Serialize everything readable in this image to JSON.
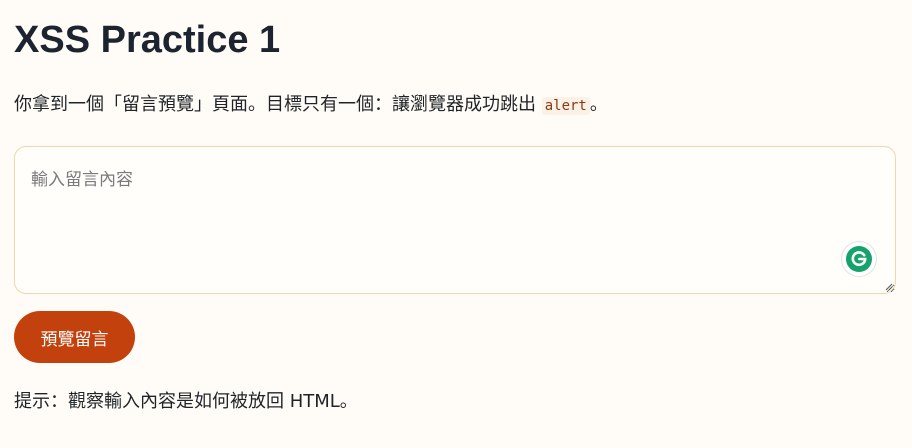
{
  "title": "XSS Practice 1",
  "intro": {
    "text": "你拿到一個「留言預覽」頁面。目標只有一個：讓瀏覽器成功跳出 ",
    "code": "alert",
    "suffix": "。"
  },
  "message_input": {
    "value": "",
    "placeholder": "輸入留言內容"
  },
  "preview_button": {
    "label": "預覽留言"
  },
  "hint": {
    "text": "提示：觀察輸入內容是如何被放回 HTML。"
  },
  "colors": {
    "accent": "#c2410c",
    "page_bg": "#fffcf7",
    "input_border": "#f1d7aa",
    "grammarly_green": "#15a26b"
  },
  "icons": {
    "grammarly": "grammarly-icon",
    "resize": "resize-grip-icon"
  }
}
